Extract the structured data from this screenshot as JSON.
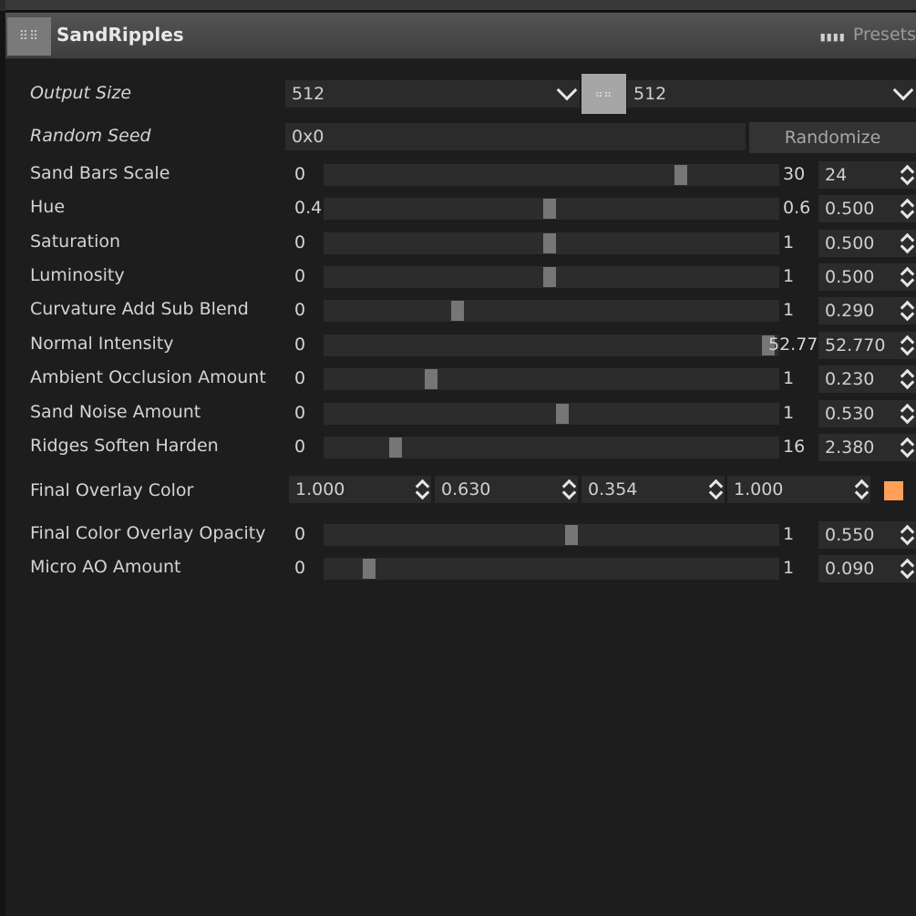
{
  "panel": {
    "title": "SandRipples",
    "presets_label": "Presets",
    "presets_icon": "grip-dots-icon"
  },
  "output_size": {
    "label": "Output Size",
    "width": "512",
    "height": "512",
    "link_icon": "link-icon"
  },
  "random_seed": {
    "label": "Random Seed",
    "value": "0x0",
    "button": "Randomize"
  },
  "sliders": [
    {
      "label": "Sand Bars Scale",
      "min": "0",
      "max": "30",
      "value": "24",
      "fraction": 0.8
    },
    {
      "label": "Hue",
      "min": "0.4",
      "max": "0.6",
      "value": "0.500",
      "fraction": 0.5
    },
    {
      "label": "Saturation",
      "min": "0",
      "max": "1",
      "value": "0.500",
      "fraction": 0.5
    },
    {
      "label": "Luminosity",
      "min": "0",
      "max": "1",
      "value": "0.500",
      "fraction": 0.5
    },
    {
      "label": "Curvature Add Sub Blend",
      "min": "0",
      "max": "1",
      "value": "0.290",
      "fraction": 0.29
    },
    {
      "label": "Normal Intensity",
      "min": "0",
      "max": "52.77",
      "value": "52.770",
      "fraction": 1.0
    },
    {
      "label": "Ambient Occlusion Amount",
      "min": "0",
      "max": "1",
      "value": "0.230",
      "fraction": 0.23
    },
    {
      "label": "Sand Noise Amount",
      "min": "0",
      "max": "1",
      "value": "0.530",
      "fraction": 0.53
    },
    {
      "label": "Ridges Soften Harden",
      "min": "0",
      "max": "16",
      "value": "2.380",
      "fraction": 0.149
    }
  ],
  "overlay_color": {
    "label": "Final Overlay Color",
    "r": "1.000",
    "g": "0.630",
    "b": "0.354",
    "a": "1.000",
    "swatch": "#ff9f5a"
  },
  "sliders2": [
    {
      "label": "Final Color Overlay Opacity",
      "min": "0",
      "max": "1",
      "value": "0.550",
      "fraction": 0.55
    },
    {
      "label": "Micro AO Amount",
      "min": "0",
      "max": "1",
      "value": "0.090",
      "fraction": 0.09
    }
  ]
}
